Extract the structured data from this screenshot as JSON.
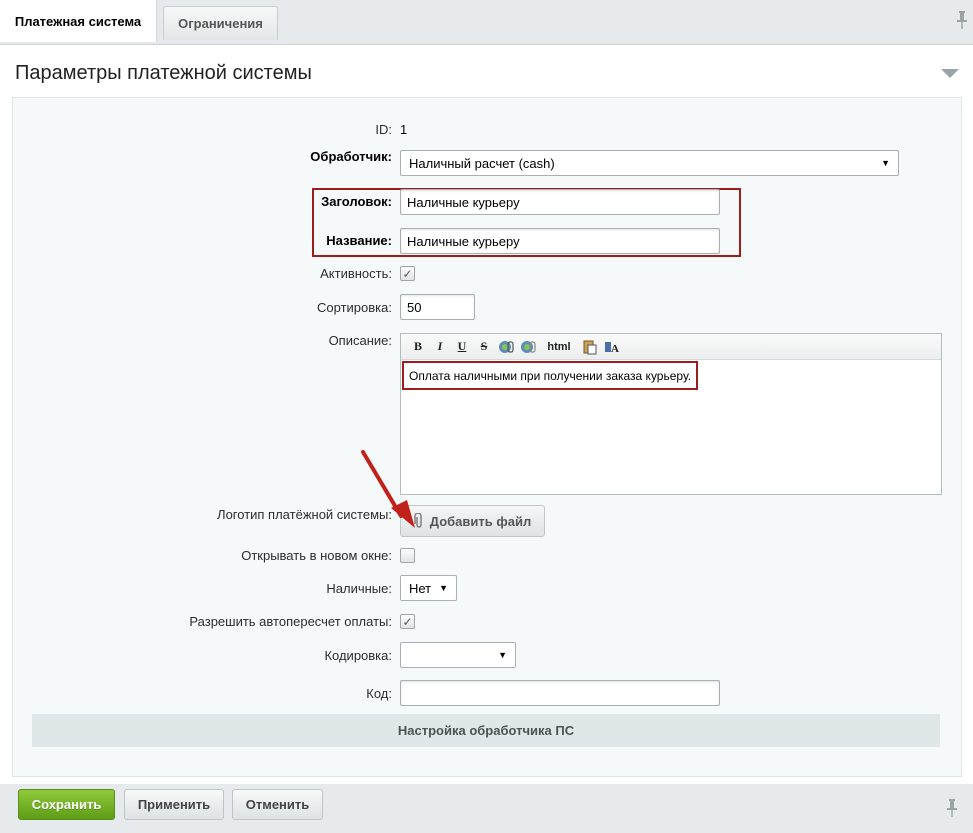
{
  "tabs": {
    "active": "Платежная система",
    "inactive": "Ограничения"
  },
  "panel": {
    "title": "Параметры платежной системы"
  },
  "form": {
    "id_label": "ID:",
    "id_value": "1",
    "handler_label": "Обработчик:",
    "handler_value": "Наличный расчет (cash)",
    "header_label": "Заголовок:",
    "header_value": "Наличные курьеру",
    "name_label": "Название:",
    "name_value": "Наличные курьеру",
    "active_label": "Активность:",
    "active_checked": true,
    "sort_label": "Сортировка:",
    "sort_value": "50",
    "description_label": "Описание:",
    "description_value": "Оплата наличными при получении заказа курьеру.",
    "editor_toolbar": {
      "bold": "B",
      "italic": "I",
      "underline": "U",
      "strike": "S",
      "html": "html"
    },
    "logo_label": "Логотип платёжной системы:",
    "add_file_label": "Добавить файл",
    "new_window_label": "Открывать в новом окне:",
    "new_window_checked": false,
    "cash_label": "Наличные:",
    "cash_value": "Нет",
    "autorecalc_label": "Разрешить автопересчет оплаты:",
    "autorecalc_checked": true,
    "encoding_label": "Кодировка:",
    "encoding_value": "",
    "code_label": "Код:",
    "code_value": "",
    "handler_settings_label": "Настройка обработчика ПС"
  },
  "buttons": {
    "save": "Сохранить",
    "apply": "Применить",
    "cancel": "Отменить"
  },
  "colors": {
    "save_button": "#6aa81f",
    "highlight_box": "#9d1c1c",
    "annotation_arrow": "#c0211a"
  },
  "icons": {
    "pin": "pin-icon",
    "collapse": "triangle-down-icon",
    "attach": "paperclip-icon"
  }
}
